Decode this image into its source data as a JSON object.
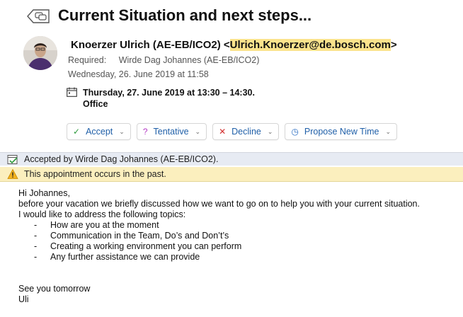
{
  "header": {
    "subject": "Current Situation and next steps...",
    "sender_name": "Knoerzer Ulrich (AE-EB/ICO2)",
    "sender_email": "Ulrich.Knoerzer@de.bosch.com",
    "required_label": "Required:",
    "required_value": "Wirde Dag Johannes (AE-EB/ICO2)",
    "sent": "Wednesday, 26. June 2019 at 11:58",
    "when_line1": "Thursday, 27. June 2019 at 13:30 – 14:30.",
    "when_line2": "Office"
  },
  "actions": {
    "accept": "Accept",
    "tentative": "Tentative",
    "decline": "Decline",
    "propose": "Propose New Time"
  },
  "bars": {
    "accepted": "Accepted by Wirde Dag Johannes (AE-EB/ICO2).",
    "past_warning": "This appointment occurs in the past."
  },
  "body": {
    "greeting": "Hi Johannes,",
    "line1": "before your vacation we briefly discussed how we want to go on to help you with your current situation.",
    "line2": "I would like to address the following topics:",
    "topics": [
      "How are you at the moment",
      "Communication in the Team, Do’s and Don’t’s",
      "Creating a working environment you can perform",
      "Any further assistance we can provide"
    ],
    "closing": "See you tomorrow",
    "signature": "Uli"
  },
  "colors": {
    "accent_blue": "#1f5fa8",
    "email_highlight": "#fbe38c",
    "warning_bar": "#fbefbe",
    "info_bar": "#e7ebf3"
  }
}
